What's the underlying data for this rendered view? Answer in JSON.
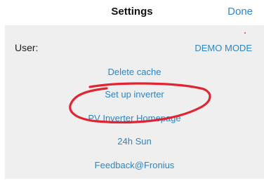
{
  "nav": {
    "title": "Settings",
    "done_label": "Done"
  },
  "settings": {
    "user_label": "User:",
    "user_value": "DEMO MODE",
    "items": [
      {
        "label": "Delete cache"
      },
      {
        "label": "Set up inverter"
      },
      {
        "label": "PV Inverter Homepage"
      },
      {
        "label": "24h Sun"
      },
      {
        "label": "Feedback@Fronius"
      }
    ]
  },
  "colors": {
    "link": "#2f84c4",
    "panel_background": "#efeff0",
    "highlight_ring": "#e02432"
  }
}
